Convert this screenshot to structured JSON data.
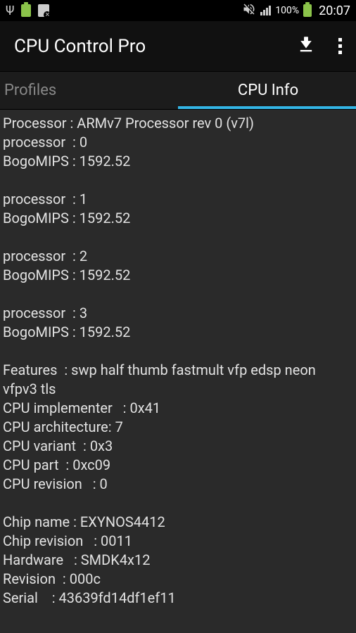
{
  "status": {
    "battery_pct": "100%",
    "time": "20:07"
  },
  "app_bar": {
    "title": "CPU Control Pro"
  },
  "tabs": {
    "profiles": "Profiles",
    "cpu_info": "CPU Info"
  },
  "cpu_info_text": "Processor : ARMv7 Processor rev 0 (v7l)\nprocessor  : 0\nBogoMIPS : 1592.52\n\nprocessor  : 1\nBogoMIPS : 1592.52\n\nprocessor  : 2\nBogoMIPS : 1592.52\n\nprocessor  : 3\nBogoMIPS : 1592.52\n\nFeatures  : swp half thumb fastmult vfp edsp neon vfpv3 tls\nCPU implementer   : 0x41\nCPU architecture: 7\nCPU variant  : 0x3\nCPU part  : 0xc09\nCPU revision   : 0\n\nChip name : EXYNOS4412\nChip revision   : 0011\nHardware   : SMDK4x12\nRevision  : 000c\nSerial    : 43639fd14df1ef11"
}
